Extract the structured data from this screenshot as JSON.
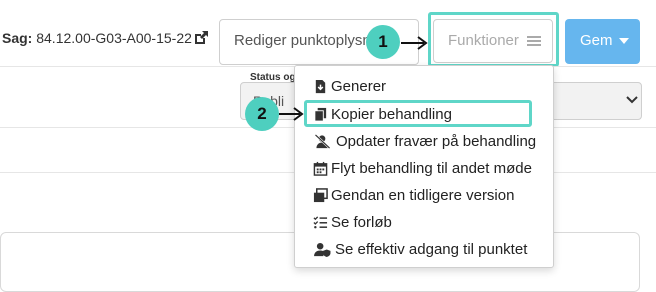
{
  "header": {
    "sag_label": "Sag:",
    "sag_value": "84.12.00-G03-A00-15-22",
    "edit_button": "Rediger punktoplysni",
    "functions_button": "Funktioner",
    "save_button": "Gem"
  },
  "status": {
    "label": "Status og",
    "value": "Publi"
  },
  "callouts": [
    "1",
    "2"
  ],
  "menu": {
    "items": [
      {
        "label": "Generer",
        "icon": "download-icon"
      },
      {
        "label": "Kopier behandling",
        "icon": "copy-icon"
      },
      {
        "label": "Opdater fravær på behandling",
        "icon": "user-slash-icon"
      },
      {
        "label": "Flyt behandling til andet møde",
        "icon": "calendar-icon"
      },
      {
        "label": "Gendan en tidligere version",
        "icon": "window-restore-icon"
      },
      {
        "label": "Se forløb",
        "icon": "list-check-icon"
      },
      {
        "label": "Se effektiv adgang til punktet",
        "icon": "user-shield-icon"
      }
    ],
    "highlighted_index": 1
  },
  "colors": {
    "accent_teal": "#4ecfbf",
    "primary_blue": "#66b6ee"
  }
}
